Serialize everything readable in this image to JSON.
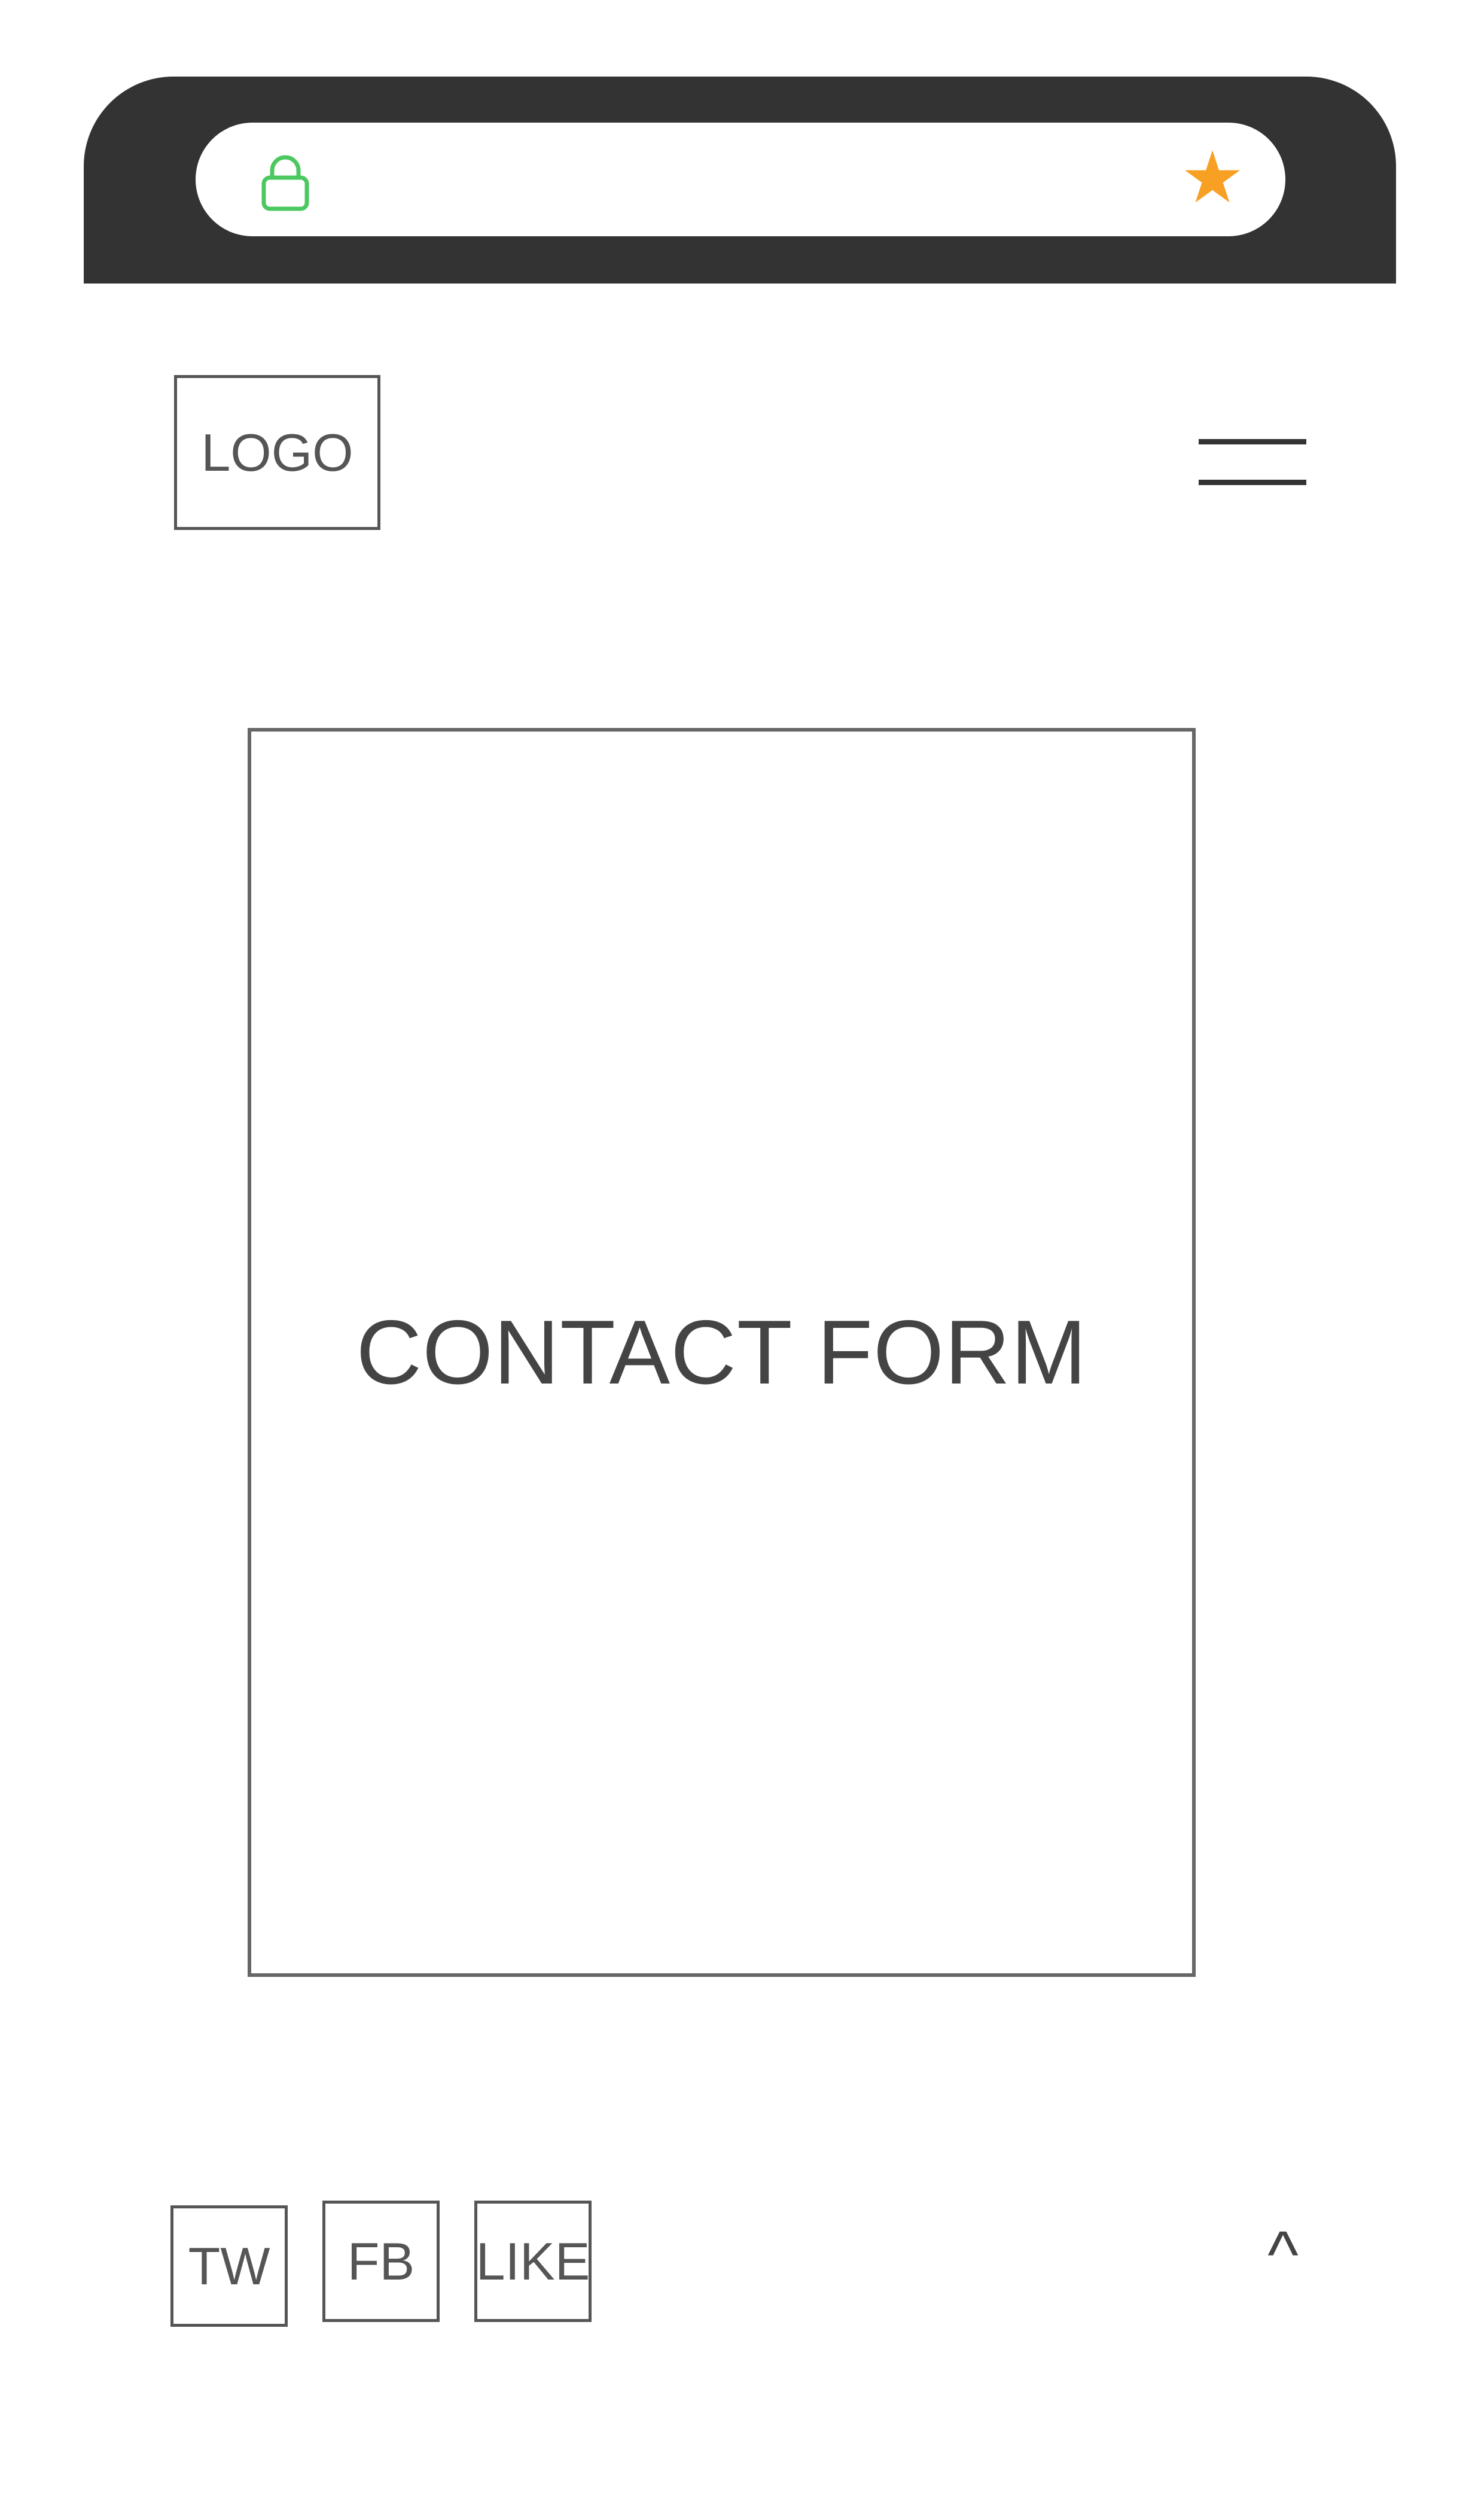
{
  "browser": {
    "lock_icon": "lock-icon",
    "bookmark_icon": "star-icon",
    "bookmark_glyph": "★",
    "colors": {
      "chrome": "#333333",
      "lock": "#4cc860",
      "star": "#f7a024"
    }
  },
  "header": {
    "logo_label": "LOGO",
    "menu_icon": "hamburger-menu-icon"
  },
  "main": {
    "contact_form_label": "CONTACT FORM"
  },
  "footer": {
    "social": [
      {
        "label": "TW"
      },
      {
        "label": "FB"
      },
      {
        "label": "LIKE"
      }
    ],
    "scroll_top_label": "^"
  }
}
